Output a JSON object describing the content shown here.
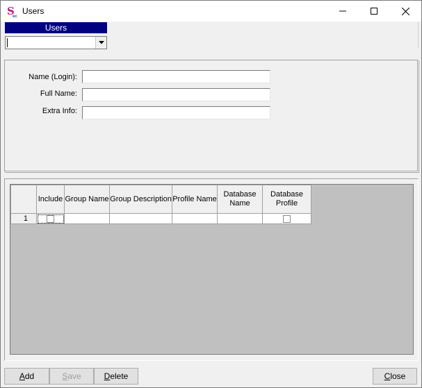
{
  "window": {
    "title": "Users",
    "app_icon": "S",
    "app_icon_sub": "ec",
    "controls": [
      "minimize-icon",
      "maximize-icon",
      "close-icon"
    ]
  },
  "selector": {
    "header": "Users",
    "value": ""
  },
  "form": {
    "name_label": "Name (Login):",
    "name_value": "",
    "fullname_label": "Full Name:",
    "fullname_value": "",
    "extra_label": "Extra Info:",
    "extra_value": ""
  },
  "grid": {
    "columns": {
      "include": "Include",
      "group_name": "Group Name",
      "group_description": "Group Description",
      "profile_name": "Profile Name",
      "database_name_1": "Database",
      "database_name_2": "Name",
      "database_profile_1": "Database",
      "database_profile_2": "Profile"
    },
    "rows": [
      {
        "num": "1",
        "include": false,
        "group_name": "",
        "group_description": "",
        "profile_name": "",
        "database_name": "",
        "database_profile": false
      }
    ]
  },
  "buttons": {
    "add_prefix": "A",
    "add_rest": "dd",
    "save_prefix": "S",
    "save_rest": "ave",
    "save_enabled": false,
    "delete_prefix": "D",
    "delete_rest": "elete",
    "close_prefix": "C",
    "close_rest": "lose"
  },
  "colors": {
    "header_bg": "#000080",
    "app_icon": "#c0198a",
    "grid_bg": "#c0c0c0"
  }
}
